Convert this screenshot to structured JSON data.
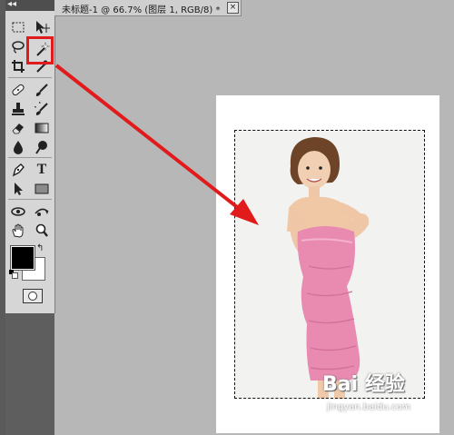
{
  "document_tab": {
    "title": "未标题-1 @ 66.7% (图层 1, RGB/8) *",
    "close_glyph": "×"
  },
  "toolbox": {
    "collapse_glyph": "◂◂",
    "tools": [
      {
        "name": "rectangular-marquee-icon"
      },
      {
        "name": "move-icon"
      },
      {
        "name": "lasso-icon"
      },
      {
        "name": "magic-wand-icon",
        "selected": true
      },
      {
        "name": "crop-icon"
      },
      {
        "name": "eyedropper-icon"
      },
      {
        "name": "healing-brush-icon"
      },
      {
        "name": "brush-icon"
      },
      {
        "name": "clone-stamp-icon"
      },
      {
        "name": "history-brush-icon"
      },
      {
        "name": "eraser-icon"
      },
      {
        "name": "gradient-icon"
      },
      {
        "name": "blur-icon"
      },
      {
        "name": "dodge-icon"
      },
      {
        "name": "pen-icon"
      },
      {
        "name": "type-icon"
      },
      {
        "name": "path-selection-icon"
      },
      {
        "name": "rectangle-shape-icon"
      },
      {
        "name": "3d-rotate-icon"
      },
      {
        "name": "3d-orbit-icon"
      },
      {
        "name": "hand-icon"
      },
      {
        "name": "zoom-icon"
      }
    ],
    "type_tool_glyph": "T",
    "foreground_color": "#000000",
    "background_color": "#ffffff",
    "swap_glyph": "↰"
  },
  "watermark": {
    "brand": "Bai 经验",
    "url": "jingyan.baidu.com"
  },
  "colors": {
    "annotation_red": "#e11b1b",
    "workspace_gray": "#b7b7b7",
    "panel_dark": "#5e5e5e"
  }
}
